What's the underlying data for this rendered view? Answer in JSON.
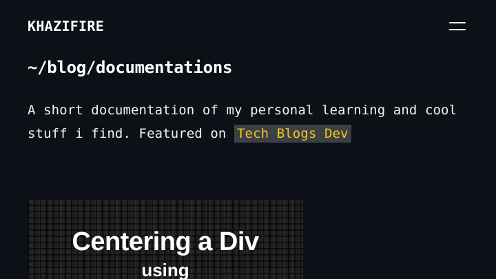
{
  "header": {
    "brand": "KHAZIFIRE",
    "menu_icon": "hamburger-menu-icon"
  },
  "page": {
    "title": "~/blog/documentations",
    "intro_text": "A short documentation of my personal learning and cool stuff i find. Featured on ",
    "featured_link": "Tech Blogs Dev"
  },
  "posts": [
    {
      "thumbnail_title": "Centering a Div",
      "thumbnail_subtitle": "using"
    }
  ],
  "colors": {
    "background": "#0d1117",
    "text": "#f2f2f2",
    "link_accent": "#f5c518",
    "link_background": "#3b4045"
  }
}
